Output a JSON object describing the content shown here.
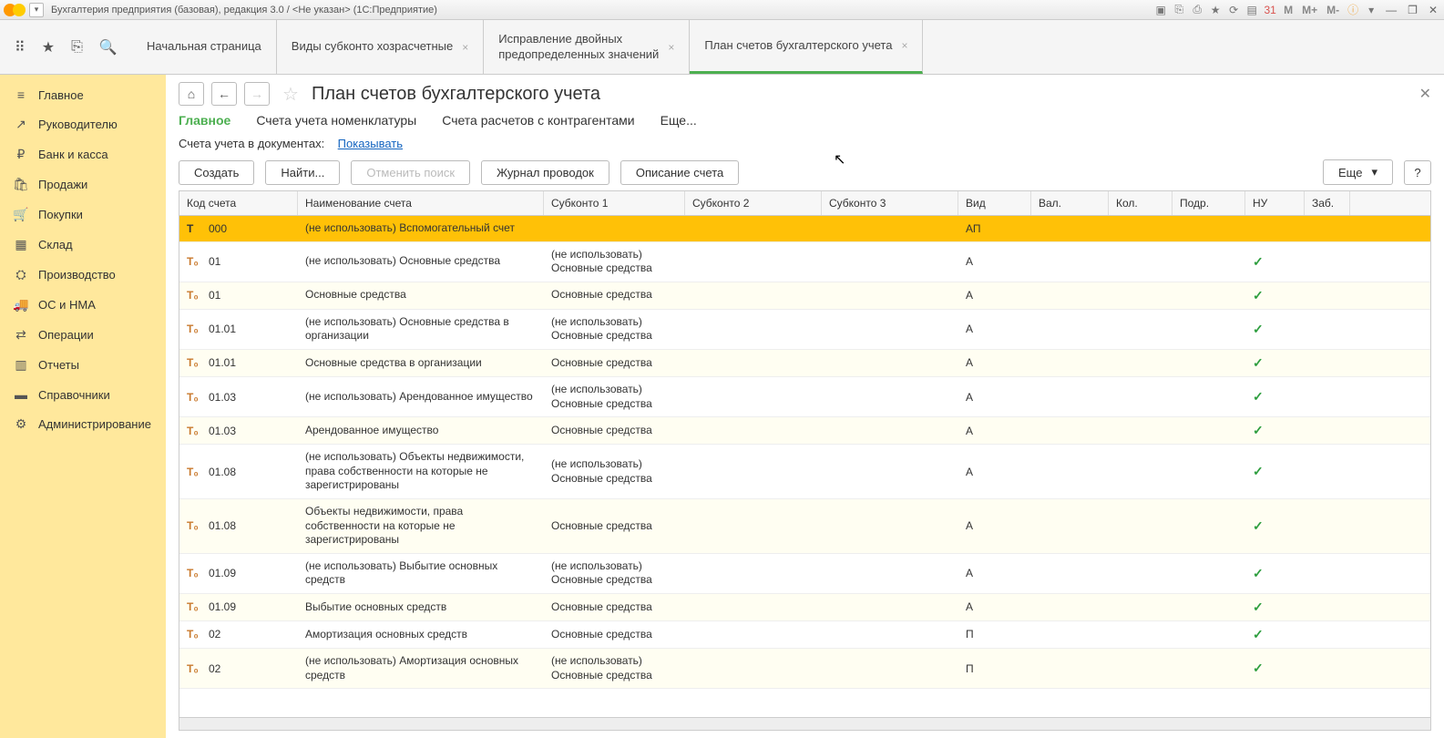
{
  "title": "Бухгалтерия предприятия (базовая), редакция 3.0 / <Не указан>  (1С:Предприятие)",
  "top_icons": {
    "m": "M",
    "mp": "M+",
    "mm": "M-"
  },
  "tabs": [
    {
      "label": "Начальная страница",
      "closable": false,
      "active": false
    },
    {
      "label": "Виды субконто хозрасчетные",
      "closable": true,
      "active": false
    },
    {
      "label": "Исправление двойных\nпредопределенных значений",
      "closable": true,
      "active": false
    },
    {
      "label": "План счетов бухгалтерского учета",
      "closable": true,
      "active": true
    }
  ],
  "sidebar": [
    {
      "icon": "≡",
      "label": "Главное"
    },
    {
      "icon": "↗",
      "label": "Руководителю"
    },
    {
      "icon": "₽",
      "label": "Банк и касса"
    },
    {
      "icon": "🛍",
      "label": "Продажи"
    },
    {
      "icon": "🛒",
      "label": "Покупки"
    },
    {
      "icon": "▦",
      "label": "Склад"
    },
    {
      "icon": "⛭",
      "label": "Производство"
    },
    {
      "icon": "🚚",
      "label": "ОС и НМА"
    },
    {
      "icon": "⇄",
      "label": "Операции"
    },
    {
      "icon": "▥",
      "label": "Отчеты"
    },
    {
      "icon": "▬",
      "label": "Справочники"
    },
    {
      "icon": "⚙",
      "label": "Администрирование"
    }
  ],
  "page": {
    "title": "План счетов бухгалтерского учета",
    "subnav": [
      {
        "label": "Главное",
        "active": true
      },
      {
        "label": "Счета учета номенклатуры",
        "active": false
      },
      {
        "label": "Счета расчетов с контрагентами",
        "active": false
      },
      {
        "label": "Еще...",
        "active": false
      }
    ],
    "doc_line_label": "Счета учета в документах:",
    "doc_line_link": "Показывать",
    "toolbar": {
      "create": "Создать",
      "find": "Найти...",
      "cancel_search": "Отменить поиск",
      "journal": "Журнал проводок",
      "desc": "Описание счета",
      "more": "Еще",
      "help": "?"
    }
  },
  "table": {
    "headers": {
      "code": "Код счета",
      "name": "Наименование счета",
      "sub1": "Субконто 1",
      "sub2": "Субконто 2",
      "sub3": "Субконто 3",
      "kind": "Вид",
      "curr": "Вал.",
      "qty": "Кол.",
      "dept": "Подр.",
      "nu": "НУ",
      "zab": "Заб."
    },
    "rows": [
      {
        "icon": "T",
        "code": "000",
        "name": "(не использовать) Вспомогательный счет",
        "sub1": "",
        "kind": "АП",
        "nu": false,
        "selected": true
      },
      {
        "icon": "T₀",
        "code": "01",
        "name": "(не использовать) Основные средства",
        "sub1": "(не использовать)\nОсновные средства",
        "kind": "А",
        "nu": true
      },
      {
        "icon": "T₀",
        "code": "01",
        "name": "Основные средства",
        "sub1": "Основные средства",
        "kind": "А",
        "nu": true
      },
      {
        "icon": "T₀",
        "code": "01.01",
        "name": "(не использовать) Основные средства в организации",
        "sub1": "(не использовать)\nОсновные средства",
        "kind": "А",
        "nu": true
      },
      {
        "icon": "T₀",
        "code": "01.01",
        "name": "Основные средства в организации",
        "sub1": "Основные средства",
        "kind": "А",
        "nu": true
      },
      {
        "icon": "T₀",
        "code": "01.03",
        "name": "(не использовать) Арендованное имущество",
        "sub1": "(не использовать)\nОсновные средства",
        "kind": "А",
        "nu": true
      },
      {
        "icon": "T₀",
        "code": "01.03",
        "name": "Арендованное имущество",
        "sub1": "Основные средства",
        "kind": "А",
        "nu": true
      },
      {
        "icon": "T₀",
        "code": "01.08",
        "name": "(не использовать) Объекты недвижимости, права собственности на которые не зарегистрированы",
        "sub1": "(не использовать)\nОсновные средства",
        "kind": "А",
        "nu": true
      },
      {
        "icon": "T₀",
        "code": "01.08",
        "name": "Объекты недвижимости, права собственности на которые не зарегистрированы",
        "sub1": "Основные средства",
        "kind": "А",
        "nu": true
      },
      {
        "icon": "T₀",
        "code": "01.09",
        "name": "(не использовать) Выбытие основных средств",
        "sub1": "(не использовать)\nОсновные средства",
        "kind": "А",
        "nu": true
      },
      {
        "icon": "T₀",
        "code": "01.09",
        "name": "Выбытие основных средств",
        "sub1": "Основные средства",
        "kind": "А",
        "nu": true
      },
      {
        "icon": "T₀",
        "code": "02",
        "name": "Амортизация основных средств",
        "sub1": "Основные средства",
        "kind": "П",
        "nu": true
      },
      {
        "icon": "T₀",
        "code": "02",
        "name": "(не использовать) Амортизация основных средств",
        "sub1": "(не использовать)\nОсновные средства",
        "kind": "П",
        "nu": true
      }
    ]
  }
}
